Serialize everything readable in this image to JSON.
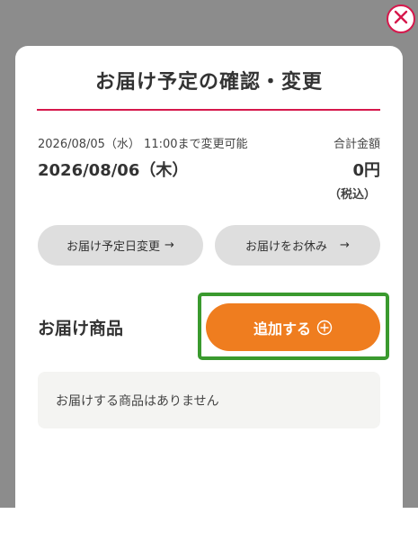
{
  "colors": {
    "backdrop": "#8c8c8c",
    "accent_red": "#d6184c",
    "primary_orange": "#ef7d1f",
    "highlight_green": "#3a9a2e",
    "pill_gray": "#dedede",
    "empty_box": "#f4f4f2"
  },
  "dialog": {
    "title": "お届け予定の確認・変更",
    "close_icon": "close-x-icon",
    "deadline": "2026/08/05（水） 11:00まで変更可能",
    "delivery_date": "2026/08/06（木）",
    "total_label": "合計金額",
    "total_amount": "0円",
    "tax_note": "（税込）",
    "buttons": {
      "change_date": "お届け予定日変更",
      "skip": "お届けをお休み",
      "arrow": "→"
    },
    "products": {
      "section_title": "お届け商品",
      "add_label": "追加する",
      "add_icon": "circle-plus-icon",
      "empty_message": "お届けする商品はありません"
    }
  }
}
